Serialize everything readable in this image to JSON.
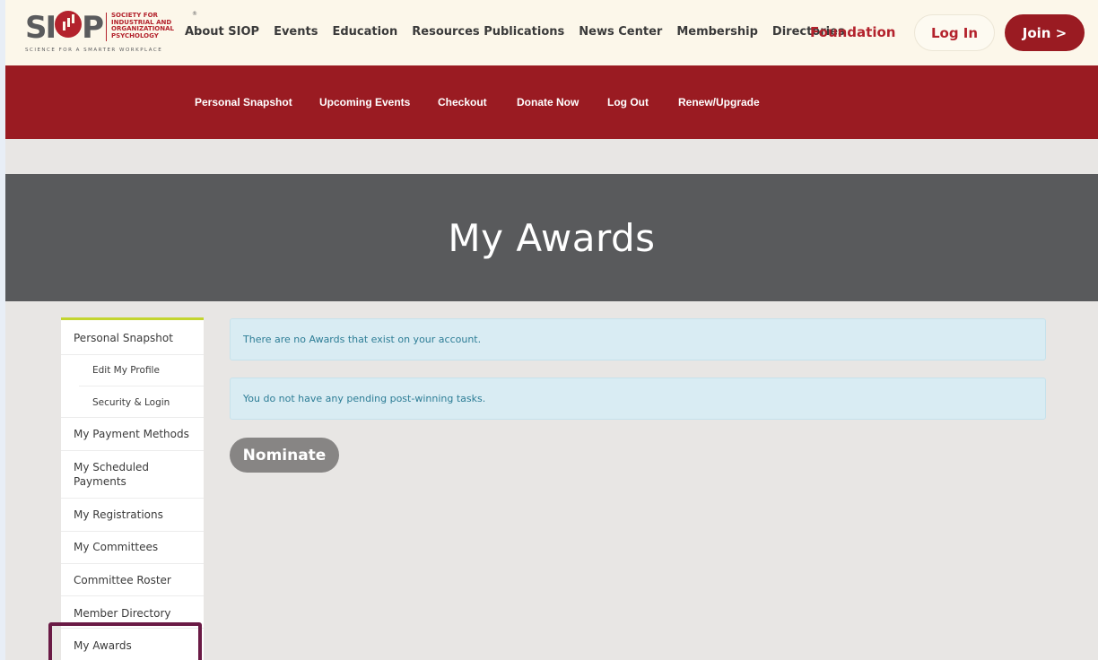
{
  "logo": {
    "mark": "SI",
    "mark_tail": "P",
    "org_lines": [
      "Society for",
      "Industrial and",
      "Organizational",
      "Psychology"
    ],
    "tagline": "SCIENCE FOR A SMARTER WORKPLACE",
    "registered": "®"
  },
  "nav": {
    "items": [
      "About SIOP",
      "Events",
      "Education",
      "Resources Publications",
      "News Center",
      "Membership",
      "Directories"
    ],
    "foundation": "Foundation",
    "login": "Log In",
    "join": "Join >"
  },
  "subnav": {
    "items": [
      "Personal Snapshot",
      "Upcoming Events",
      "Checkout",
      "Donate Now",
      "Log Out",
      "Renew/Upgrade"
    ]
  },
  "banner": {
    "title": "My Awards"
  },
  "sidebar": {
    "items": [
      "Personal Snapshot",
      "Edit My Profile",
      "Security & Login",
      "My Payment Methods",
      "My Scheduled Payments",
      "My Registrations",
      "My Committees",
      "Committee Roster",
      "Member Directory",
      "My Awards"
    ]
  },
  "main": {
    "alerts": [
      "There are no Awards that exist on your account.",
      "You do not have any pending post-winning tasks."
    ],
    "nominate": "Nominate"
  },
  "colors": {
    "brand_red": "#9a1b22",
    "banner_gray": "#595a5c",
    "accent_green": "#c3d52f",
    "highlight": "#6a1a45"
  }
}
